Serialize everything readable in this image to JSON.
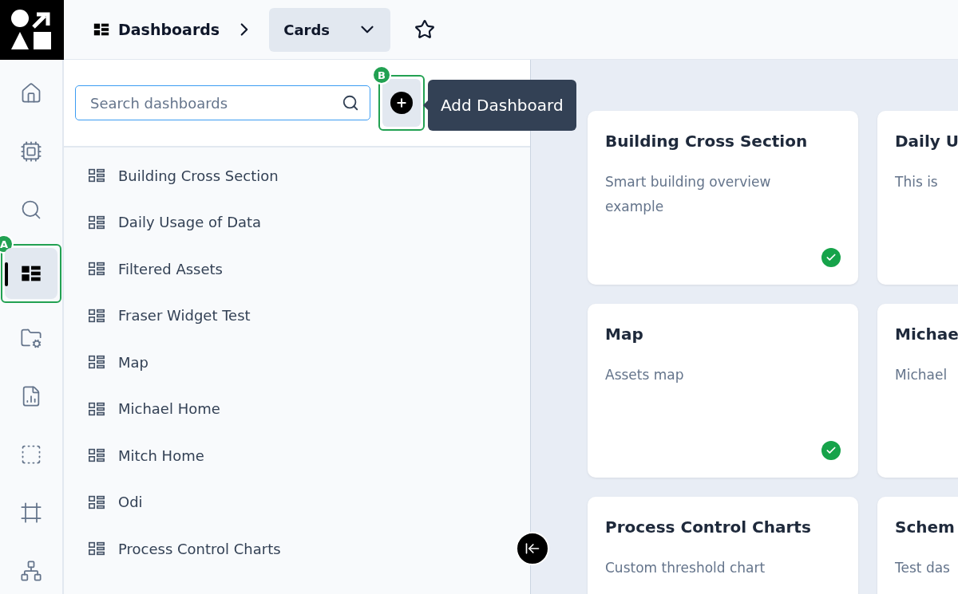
{
  "breadcrumb": {
    "section": "Dashboards",
    "current": "Cards"
  },
  "favorite": {
    "on": false
  },
  "rail": {
    "items": [
      {
        "selected": false
      },
      {
        "selected": false
      },
      {
        "selected": false
      },
      {
        "selected": true
      },
      {
        "selected": false
      },
      {
        "selected": false
      },
      {
        "selected": false
      },
      {
        "selected": false
      },
      {
        "selected": false
      }
    ]
  },
  "search": {
    "placeholder": "Search dashboards"
  },
  "add_button": {
    "tooltip": "Add Dashboard"
  },
  "annotations": [
    {
      "kind": "rail",
      "label": "A"
    },
    {
      "kind": "add",
      "label": "B"
    }
  ],
  "dashboards": [
    "Building Cross Section",
    "Daily Usage of Data",
    "Filtered Assets",
    "Fraser Widget Test",
    "Map",
    "Michael Home",
    "Mitch Home",
    "Odi",
    "Process Control Charts"
  ],
  "cards": [
    {
      "title": "Building Cross Section",
      "description": "Smart building overview example",
      "verified": true
    },
    {
      "title": "Daily U",
      "description": "This is"
    },
    {
      "title": "Map",
      "description": "Assets map",
      "verified": true
    },
    {
      "title": "Michae",
      "description": "Michael"
    },
    {
      "title": "Process Control Charts",
      "description": "Custom threshold chart"
    },
    {
      "title": "Schem",
      "description": "Test das"
    }
  ]
}
